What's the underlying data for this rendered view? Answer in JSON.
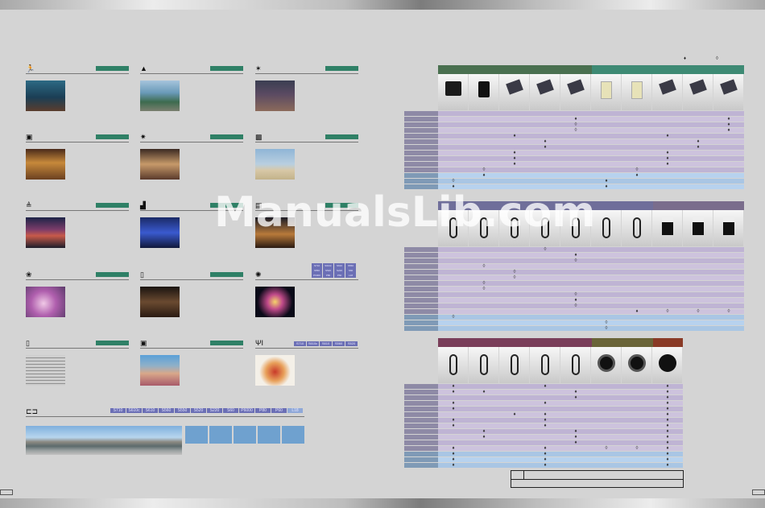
{
  "colors": {
    "scene_tag": "#2f8066",
    "chip": "#6b6fb5",
    "band_power": "#4a7050",
    "band_battery": "#3e8a74",
    "band_cable": "#6f6e9a",
    "band_flash": "#7a6d8c",
    "band_remote": "#7a3e5a",
    "band_lens": "#6a6438",
    "band_case": "#8a3a26"
  },
  "watermark": "ManualsLib.com",
  "key_filled": "♦",
  "key_open": "◊",
  "scenes": [
    {
      "icon": "runner-icon",
      "glyph": "🏃"
    },
    {
      "icon": "landscape-icon",
      "glyph": "▲"
    },
    {
      "icon": "party-icon",
      "glyph": "✶"
    },
    {
      "icon": "portrait-icon",
      "glyph": "▣"
    },
    {
      "icon": "night-portrait-icon",
      "glyph": "✷"
    },
    {
      "icon": "beach-icon",
      "glyph": "▩"
    },
    {
      "icon": "sunset-icon",
      "glyph": "≜"
    },
    {
      "icon": "night-landscape-icon",
      "glyph": "▟"
    },
    {
      "icon": "dusk-icon",
      "glyph": "▤"
    },
    {
      "icon": "close-up-icon",
      "glyph": "❀"
    },
    {
      "icon": "museum-icon",
      "glyph": "▯"
    },
    {
      "icon": "fireworks-icon",
      "glyph": "✺"
    },
    {
      "icon": "copy-icon",
      "glyph": "▯"
    },
    {
      "icon": "backlight-icon",
      "glyph": "▣"
    },
    {
      "icon": "food-icon",
      "glyph": "ΨΙ"
    }
  ],
  "fireworks_chips": [
    "S710",
    "S610c",
    "S610",
    "S560",
    "S550",
    "S520",
    "S220",
    "S60",
    "P6000",
    "P80",
    "P60",
    "L18"
  ],
  "food_chips": [
    "S710",
    "S610c",
    "S610",
    "S560",
    "S520"
  ],
  "panorama": {
    "icon": "panorama-icon",
    "chips": [
      "S710",
      "S610c",
      "S610",
      "S560",
      "S550",
      "S520",
      "S220",
      "S60",
      "P6000",
      "P80",
      "P60",
      "L18"
    ]
  }
}
